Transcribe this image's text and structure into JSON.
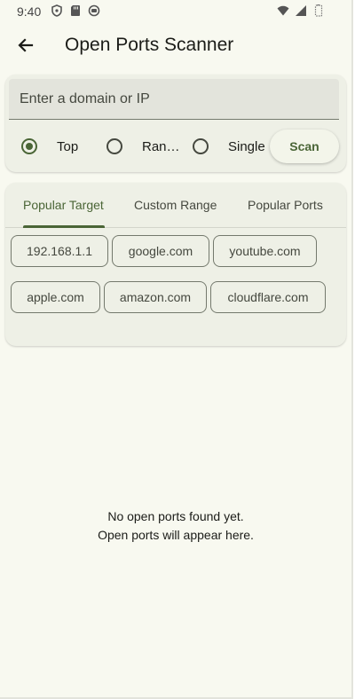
{
  "status_bar": {
    "time": "9:40",
    "left_icons": [
      "vpn-shield-icon",
      "sd-card-icon",
      "record-icon"
    ],
    "right_icons": [
      "wifi-icon",
      "cell-signal-icon",
      "battery-icon"
    ]
  },
  "app_bar": {
    "title": "Open Ports Scanner",
    "back_icon": "arrow-back-icon"
  },
  "search": {
    "placeholder": "Enter a domain or IP",
    "value": ""
  },
  "scan_modes": [
    {
      "label": "Top",
      "selected": true
    },
    {
      "label": "Ran…",
      "selected": false
    },
    {
      "label": "Single",
      "selected": false
    }
  ],
  "scan_button": "Scan",
  "tabs": [
    {
      "label": "Popular Target",
      "active": true
    },
    {
      "label": "Custom Range",
      "active": false
    },
    {
      "label": "Popular Ports",
      "active": false
    }
  ],
  "chips": [
    "192.168.1.1",
    "google.com",
    "youtube.com",
    "apple.com",
    "amazon.com",
    "cloudflare.com"
  ],
  "empty_state": {
    "line1": "No open ports found yet.",
    "line2": "Open ports will appear here."
  },
  "colors": {
    "accent": "#4a6536",
    "background": "#f8f9f0",
    "surface": "#eef0e6"
  }
}
